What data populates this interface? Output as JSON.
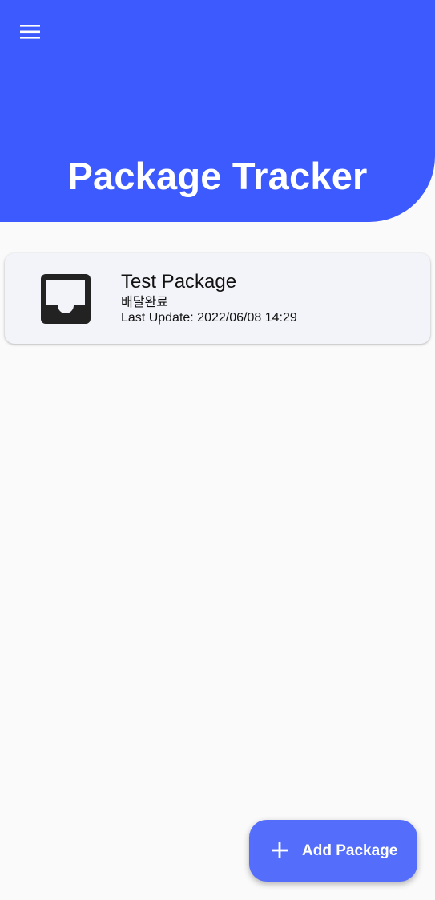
{
  "header": {
    "title": "Package Tracker",
    "menu_icon": "hamburger-menu-icon",
    "background_color": "#3d5afe"
  },
  "packages": [
    {
      "name": "Test Package",
      "status": "배달완료",
      "last_update": "Last Update: 2022/06/08 14:29",
      "icon": "inbox-tray-icon"
    }
  ],
  "fab": {
    "label": "Add Package",
    "icon": "plus-icon",
    "color": "#546dfb"
  }
}
